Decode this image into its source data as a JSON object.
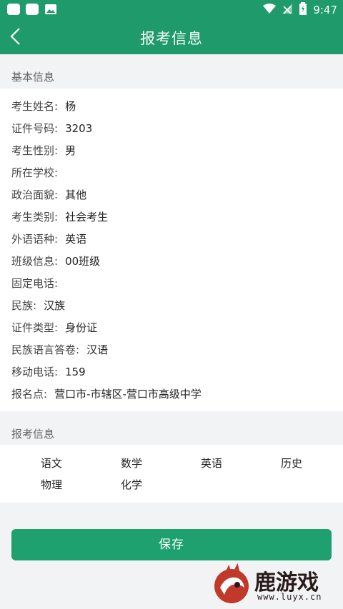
{
  "status_bar": {
    "time": "9:47"
  },
  "app_bar": {
    "title": "报考信息"
  },
  "basic_section": {
    "header": "基本信息",
    "fields": [
      {
        "label": "考生姓名:",
        "value": "杨"
      },
      {
        "label": "证件号码:",
        "value": "3203"
      },
      {
        "label": "考生性别:",
        "value": "男"
      },
      {
        "label": "所在学校:",
        "value": ""
      },
      {
        "label": "政治面貌:",
        "value": "其他"
      },
      {
        "label": "考生类别:",
        "value": "社会考生"
      },
      {
        "label": "外语语种:",
        "value": "英语"
      },
      {
        "label": "班级信息:",
        "value": "00班级"
      },
      {
        "label": "固定电话:",
        "value": ""
      },
      {
        "label": "民族:",
        "value": "汉族"
      },
      {
        "label": "证件类型:",
        "value": "身份证"
      },
      {
        "label": "民族语言答卷:",
        "value": "汉语"
      },
      {
        "label": "移动电话:",
        "value": "159"
      },
      {
        "label": "报名点:",
        "value": "营口市-市辖区-营口市高级中学"
      }
    ]
  },
  "exam_section": {
    "header": "报考信息",
    "subjects": [
      "语文",
      "数学",
      "英语",
      "历史",
      "物理",
      "化学"
    ]
  },
  "save_button": {
    "label": "保存"
  },
  "watermark": {
    "text": "鹿游戏",
    "url": "www.luyx.cn"
  }
}
